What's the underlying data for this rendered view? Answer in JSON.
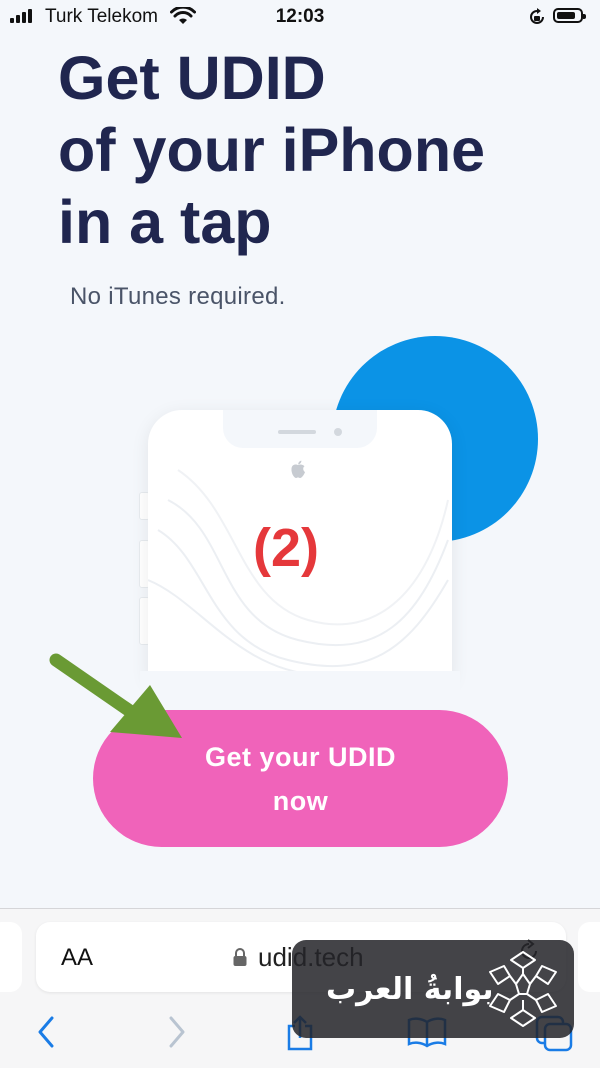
{
  "status_bar": {
    "carrier": "Turk Telekom",
    "time": "12:03"
  },
  "hero": {
    "headline_lines": [
      "Get UDID",
      "of your iPhone",
      "in a tap"
    ],
    "subline": "No iTunes required.",
    "step_number": "(2)"
  },
  "cta": {
    "label_line1": "Get your UDID",
    "label_line2": "now"
  },
  "browser": {
    "text_size_label": "AA",
    "url": "udid.tech",
    "icons": [
      "back-icon",
      "forward-icon",
      "share-icon",
      "bookmarks-icon",
      "tabs-icon",
      "reload-icon",
      "lock-icon"
    ]
  },
  "watermark": {
    "text": "بوابةُ العرب"
  },
  "colors": {
    "headline": "#20264f",
    "cta_background": "#f063ba",
    "accent_circle": "#0b93e6",
    "step_number": "#e5383b",
    "annotation_arrow": "#6a9a34",
    "ios_blue": "#1a7ce6"
  }
}
